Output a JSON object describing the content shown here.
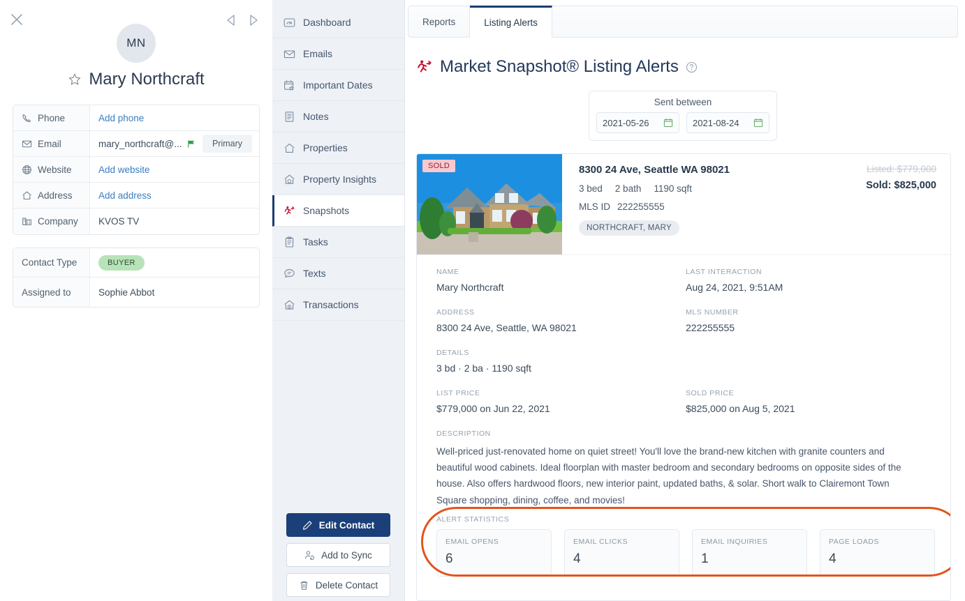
{
  "contact": {
    "initials": "MN",
    "name": "Mary Northcraft",
    "fields": [
      {
        "label": "Phone",
        "icon": "phone-icon",
        "value": "Add phone",
        "is_link": true
      },
      {
        "label": "Email",
        "icon": "envelope-icon",
        "value": "mary_northcraft@...",
        "is_link": false,
        "badge": "Primary",
        "flag": true
      },
      {
        "label": "Website",
        "icon": "globe-icon",
        "value": "Add website",
        "is_link": true
      },
      {
        "label": "Address",
        "icon": "home-icon",
        "value": "Add address",
        "is_link": true
      },
      {
        "label": "Company",
        "icon": "building-icon",
        "value": "KVOS TV",
        "is_link": false
      }
    ],
    "contact_type_label": "Contact Type",
    "contact_type_value": "BUYER",
    "assigned_label": "Assigned to",
    "assigned_value": "Sophie Abbot"
  },
  "nav": {
    "items": [
      {
        "label": "Dashboard",
        "icon": "gauge-icon",
        "active": false
      },
      {
        "label": "Emails",
        "icon": "envelope-icon",
        "active": false
      },
      {
        "label": "Important Dates",
        "icon": "calendar-star-icon",
        "active": false
      },
      {
        "label": "Notes",
        "icon": "note-icon",
        "active": false
      },
      {
        "label": "Properties",
        "icon": "home-icon",
        "active": false
      },
      {
        "label": "Property Insights",
        "icon": "home-shield-icon",
        "active": false
      },
      {
        "label": "Snapshots",
        "icon": "snapshot-runner-icon",
        "active": true
      },
      {
        "label": "Tasks",
        "icon": "clipboard-icon",
        "active": false
      },
      {
        "label": "Texts",
        "icon": "chat-icon",
        "active": false
      },
      {
        "label": "Transactions",
        "icon": "home-dollar-icon",
        "active": false
      }
    ],
    "buttons": [
      {
        "label": "Edit Contact",
        "icon": "pencil-icon",
        "style": "primary"
      },
      {
        "label": "Add to Sync",
        "icon": "user-sync-icon",
        "style": "secondary"
      },
      {
        "label": "Delete Contact",
        "icon": "trash-icon",
        "style": "secondary"
      }
    ]
  },
  "main": {
    "tabs": [
      {
        "label": "Reports",
        "active": false
      },
      {
        "label": "Listing Alerts",
        "active": true
      }
    ],
    "page_title": "Market Snapshot® Listing Alerts",
    "date_filter": {
      "label": "Sent between",
      "start": "2021-05-26",
      "end": "2021-08-24"
    },
    "listing": {
      "status_badge": "SOLD",
      "address": "8300 24 Ave, Seattle WA 98021",
      "beds": "3 bed",
      "baths": "2 bath",
      "sqft": "1190 sqft",
      "mls_label": "MLS ID",
      "mls_value": "222255555",
      "agent_chip": "NORTHCRAFT, MARY",
      "price_listed": "Listed: $779,000",
      "price_sold": "Sold: $825,000"
    },
    "details": {
      "name_label": "NAME",
      "name_value": "Mary Northcraft",
      "last_interaction_label": "LAST INTERACTION",
      "last_interaction_value": "Aug 24, 2021, 9:51AM",
      "address_label": "ADDRESS",
      "address_value": "8300 24 Ave, Seattle, WA 98021",
      "mls_number_label": "MLS NUMBER",
      "mls_number_value": "222255555",
      "details_label": "DETAILS",
      "details_value": "3 bd · 2 ba · 1190 sqft",
      "list_price_label": "LIST PRICE",
      "list_price_value": "$779,000 on Jun 22, 2021",
      "sold_price_label": "SOLD PRICE",
      "sold_price_value": "$825,000 on Aug 5, 2021",
      "description_label": "DESCRIPTION",
      "description_value": "Well-priced just-renovated home on quiet street! You'll love the brand-new kitchen with granite counters and beautiful wood cabinets. Ideal floorplan with master bedroom and secondary bedrooms on opposite sides of the house. Also offers hardwood floors, new interior paint, updated baths, & solar. Short walk to Clairemont Town Square shopping, dining, coffee, and movies!"
    },
    "alert_statistics": {
      "label": "ALERT STATISTICS",
      "cards": [
        {
          "label": "EMAIL OPENS",
          "value": "6"
        },
        {
          "label": "EMAIL CLICKS",
          "value": "4"
        },
        {
          "label": "EMAIL INQUIRIES",
          "value": "1"
        },
        {
          "label": "PAGE LOADS",
          "value": "4"
        }
      ]
    }
  },
  "colors": {
    "accent_navy": "#1a3d6d",
    "brand_red": "#c8102e",
    "annotation_orange": "#e2541c",
    "buyer_green": "#b6e3b7",
    "sold_pink": "#f9c9cf"
  }
}
